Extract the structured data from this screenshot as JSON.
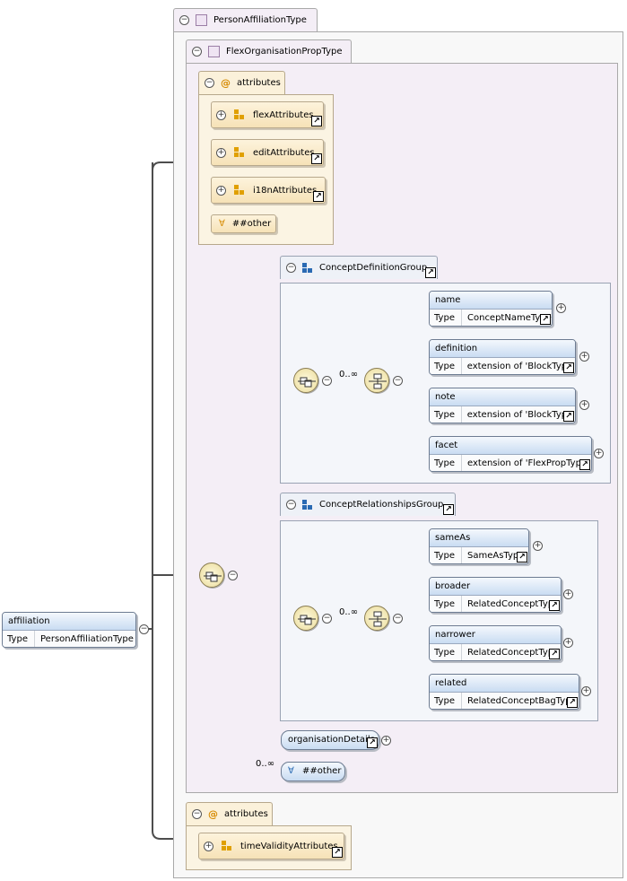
{
  "root": {
    "name": "affiliation",
    "type_key": "Type",
    "type_value": "PersonAffiliationType"
  },
  "person_type": {
    "label": "PersonAffiliationType",
    "collapse_symbol": "−"
  },
  "flex_type": {
    "label": "FlexOrganisationPropType",
    "collapse_symbol": "−"
  },
  "attributes_top": {
    "label": "attributes",
    "items": [
      "flexAttributes",
      "editAttributes",
      "i18nAttributes"
    ],
    "other": "##other"
  },
  "concept_definition_group": {
    "label": "ConceptDefinitionGroup",
    "occurrence": "0..∞",
    "elements": [
      {
        "name": "name",
        "type_key": "Type",
        "type_value": "ConceptNameType"
      },
      {
        "name": "definition",
        "type_key": "Type",
        "type_value": "extension of 'BlockType'"
      },
      {
        "name": "note",
        "type_key": "Type",
        "type_value": "extension of 'BlockType'"
      },
      {
        "name": "facet",
        "type_key": "Type",
        "type_value": "extension of 'FlexPropType'"
      }
    ]
  },
  "concept_relationships_group": {
    "label": "ConceptRelationshipsGroup",
    "occurrence": "0..∞",
    "elements": [
      {
        "name": "sameAs",
        "type_key": "Type",
        "type_value": "SameAsType"
      },
      {
        "name": "broader",
        "type_key": "Type",
        "type_value": "RelatedConceptType"
      },
      {
        "name": "narrower",
        "type_key": "Type",
        "type_value": "RelatedConceptType"
      },
      {
        "name": "related",
        "type_key": "Type",
        "type_value": "RelatedConceptBagType"
      }
    ]
  },
  "organisation_details": {
    "label": "organisationDetails"
  },
  "any_other": {
    "occurrence": "0..∞",
    "label": "##other"
  },
  "attributes_bottom": {
    "label": "attributes",
    "items": [
      "timeValidityAttributes"
    ]
  },
  "symbols": {
    "collapse": "−",
    "expand": "+",
    "at": "@",
    "any": "∀",
    "link": "↗"
  },
  "colors": {
    "element_header": "#c9dcf2",
    "attribute_fill": "#f6e2b7",
    "type_frame": "#f4eef6",
    "attribute_icon": "#d68a00",
    "group_icon": "#2a6ab3"
  }
}
